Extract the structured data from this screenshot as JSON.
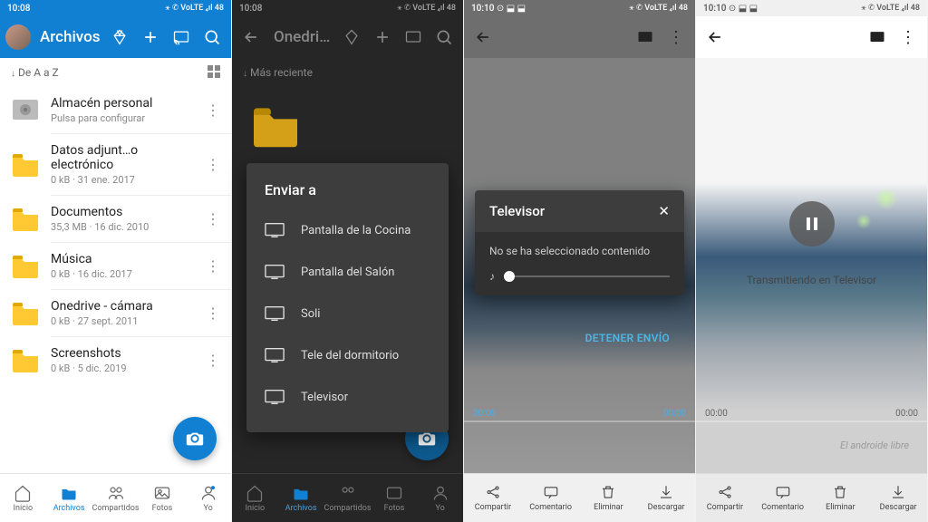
{
  "status": {
    "time1": "10:08",
    "time2": "10:08",
    "time3": "10:10",
    "time4": "10:10",
    "icons": "⚹ ✆ VoLTE ₄ıl 48"
  },
  "p1": {
    "title": "Archivos",
    "sort": "De A a Z",
    "files": [
      {
        "name": "Almacén personal",
        "meta": "Pulsa para configurar",
        "type": "vault"
      },
      {
        "name": "Datos adjunt…o electrónico",
        "meta": "0 kB · 31 ene. 2017",
        "type": "folder"
      },
      {
        "name": "Documentos",
        "meta": "35,3 MB · 16 dic. 2010",
        "type": "folder"
      },
      {
        "name": "Música",
        "meta": "0 kB · 16 dic. 2017",
        "type": "folder"
      },
      {
        "name": "Onedrive - cámara",
        "meta": "0 kB · 27 sept. 2011",
        "type": "folder"
      },
      {
        "name": "Screenshots",
        "meta": "0 kB · 5 dic. 2019",
        "type": "folder"
      }
    ]
  },
  "p2": {
    "title": "Onedri…",
    "sort": "Más reciente",
    "cast_title": "Enviar a",
    "devices": [
      "Pantalla de la Cocina",
      "Pantalla del Salón",
      "Soli",
      "Tele del dormitorio",
      "Televisor"
    ]
  },
  "p3": {
    "device": "Televisor",
    "msg": "No se ha seleccionado contenido",
    "stop": "DETENER ENVÍO",
    "time_start": "00:00",
    "time_end": "00:00"
  },
  "p4": {
    "casting": "Transmitiendo en Televisor",
    "watermark": "El androide libre",
    "time_start": "00:00",
    "time_end": "00:00"
  },
  "nav": {
    "inicio": "Inicio",
    "archivos": "Archivos",
    "compartidos": "Compartidos",
    "fotos": "Fotos",
    "yo": "Yo"
  },
  "actions": {
    "compartir": "Compartir",
    "comentario": "Comentario",
    "eliminar": "Eliminar",
    "descargar": "Descargar"
  }
}
